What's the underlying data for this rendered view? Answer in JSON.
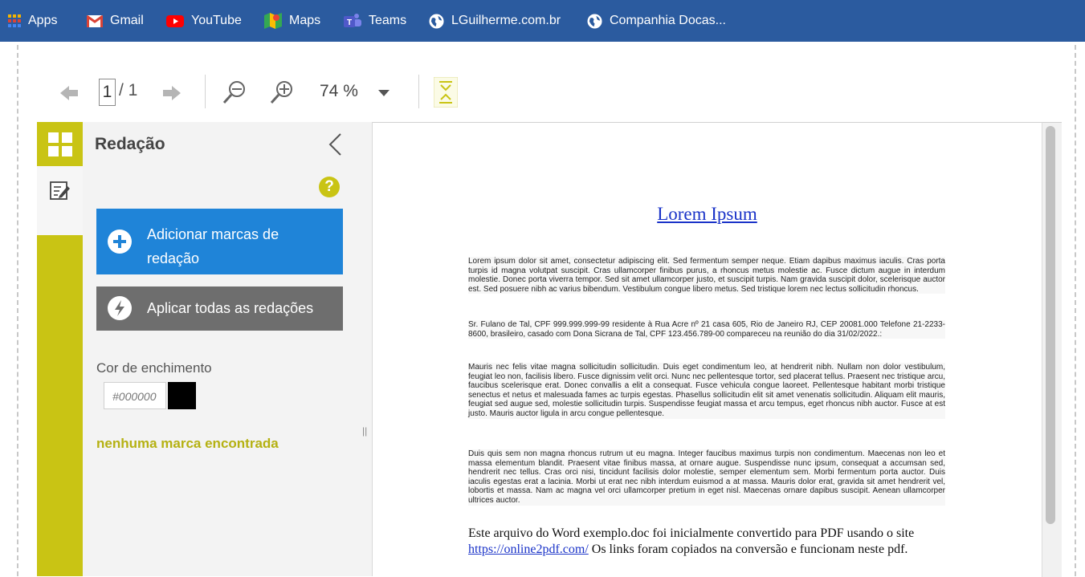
{
  "bookmarks": [
    {
      "label": "Apps",
      "icon": "apps-grid-icon"
    },
    {
      "label": "Gmail",
      "icon": "gmail-icon"
    },
    {
      "label": "YouTube",
      "icon": "youtube-icon"
    },
    {
      "label": "Maps",
      "icon": "maps-icon"
    },
    {
      "label": "Teams",
      "icon": "teams-icon"
    },
    {
      "label": "LGuilherme.com.br",
      "icon": "globe-icon"
    },
    {
      "label": "Companhia Docas...",
      "icon": "globe-icon"
    }
  ],
  "toolbar": {
    "page_current": "1",
    "page_total": "/ 1",
    "zoom": "74 %"
  },
  "panel": {
    "title": "Redação",
    "add_button": "Adicionar marcas de redação",
    "apply_button": "Aplicar todas as redações",
    "fill_label": "Cor de enchimento",
    "fill_value": "#000000",
    "fill_color": "#000000",
    "empty_message": "nenhuma marca encontrada"
  },
  "document": {
    "title": "Lorem Ipsum",
    "paragraphs": [
      "Lorem ipsum dolor sit amet, consectetur adipiscing elit. Sed fermentum semper neque. Etiam dapibus maximus iaculis. Cras porta turpis id magna volutpat suscipit. Cras ullamcorper finibus purus, a rhoncus metus molestie ac. Fusce dictum augue in interdum molestie. Donec porta viverra tempor. Sed sit amet ullamcorper justo, et suscipit turpis. Nam gravida suscipit dolor, scelerisque auctor est. Sed posuere nibh ac varius bibendum. Vestibulum congue libero metus. Sed tristique lorem nec lectus sollicitudin rhoncus.",
      "Sr. Fulano de Tal, CPF 999.999.999-99 residente à Rua Acre nº 21 casa 605, Rio de Janeiro RJ, CEP 20081.000 Telefone 21-2233-8600, brasileiro, casado com Dona Sicrana de Tal, CPF 123.456.789-00 compareceu na reunião do dia 31/02/2022.:",
      "Mauris nec felis vitae magna sollicitudin sollicitudin. Duis eget condimentum leo, at hendrerit nibh. Nullam non dolor vestibulum, feugiat leo non, facilisis libero. Fusce dignissim velit orci. Nunc nec pellentesque tortor, sed placerat tellus. Praesent nec tristique arcu, faucibus scelerisque erat. Donec convallis a elit a consequat. Fusce vehicula congue laoreet. Pellentesque habitant morbi tristique senectus et netus et malesuada fames ac turpis egestas. Phasellus sollicitudin elit sit amet venenatis sollicitudin. Aliquam elit mauris, feugiat sed augue sed, molestie sollicitudin turpis. Suspendisse feugiat massa et arcu tempus, eget rhoncus nibh auctor. Fusce at est justo. Mauris auctor ligula in arcu congue pellentesque.",
      "Duis quis sem non magna rhoncus rutrum ut eu magna. Integer faucibus maximus turpis non condimentum. Maecenas non leo et massa elementum blandit. Praesent vitae finibus massa, at ornare augue. Suspendisse nunc ipsum, consequat a accumsan sed, hendrerit nec tellus. Cras orci nisi, tincidunt facilisis dolor molestie, semper elementum sem. Morbi fermentum porta auctor. Duis iaculis egestas erat a lacinia. Morbi ut erat nec nibh interdum euismod a at massa. Mauris dolor erat, gravida sit amet hendrerit vel, lobortis et massa. Nam ac magna vel orci ullamcorper pretium in eget nisl. Maecenas ornare dapibus suscipit. Aenean ullamcorper ultrices auctor."
    ],
    "final_text_before": "Este arquivo do Word exemplo.doc foi inicialmente convertido para PDF usando o site",
    "final_link": "https://online2pdf.com/",
    "final_text_after": " Os links foram copiados na conversão e funcionam neste pdf."
  },
  "colors": {
    "bookmark_bar": "#2b5b9f",
    "accent": "#c9c414",
    "primary_button": "#1f84d8",
    "secondary_button": "#6e6e6e",
    "link": "#1a33c8"
  }
}
